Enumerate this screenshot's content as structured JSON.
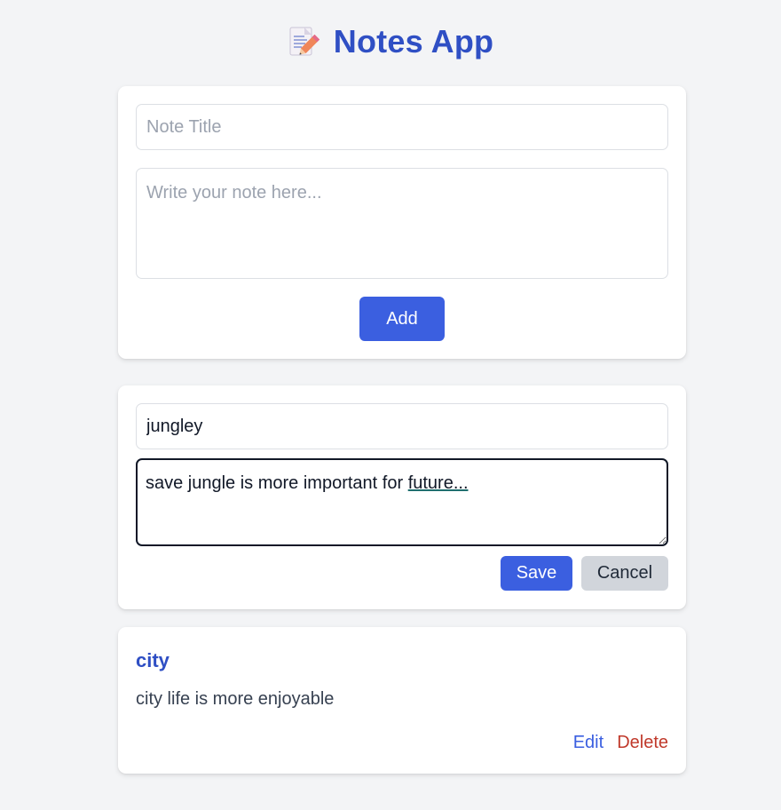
{
  "app": {
    "title": "Notes App",
    "icon": "memo-pencil-icon"
  },
  "new_note_form": {
    "title_placeholder": "Note Title",
    "title_value": "",
    "body_placeholder": "Write your note here...",
    "body_value": "",
    "add_label": "Add"
  },
  "editing_note": {
    "title_value": "jungley",
    "body_prefix": "save jungle is more important for ",
    "body_underlined": "future...",
    "save_label": "Save",
    "cancel_label": "Cancel"
  },
  "notes": [
    {
      "title": "city",
      "body": "city life is more enjoyable",
      "edit_label": "Edit",
      "delete_label": "Delete"
    }
  ],
  "colors": {
    "accent": "#2f4fc4",
    "primary_button": "#3b5fe0",
    "secondary_button": "#d1d5db",
    "delete": "#c0392b",
    "background": "#f3f4f6"
  }
}
